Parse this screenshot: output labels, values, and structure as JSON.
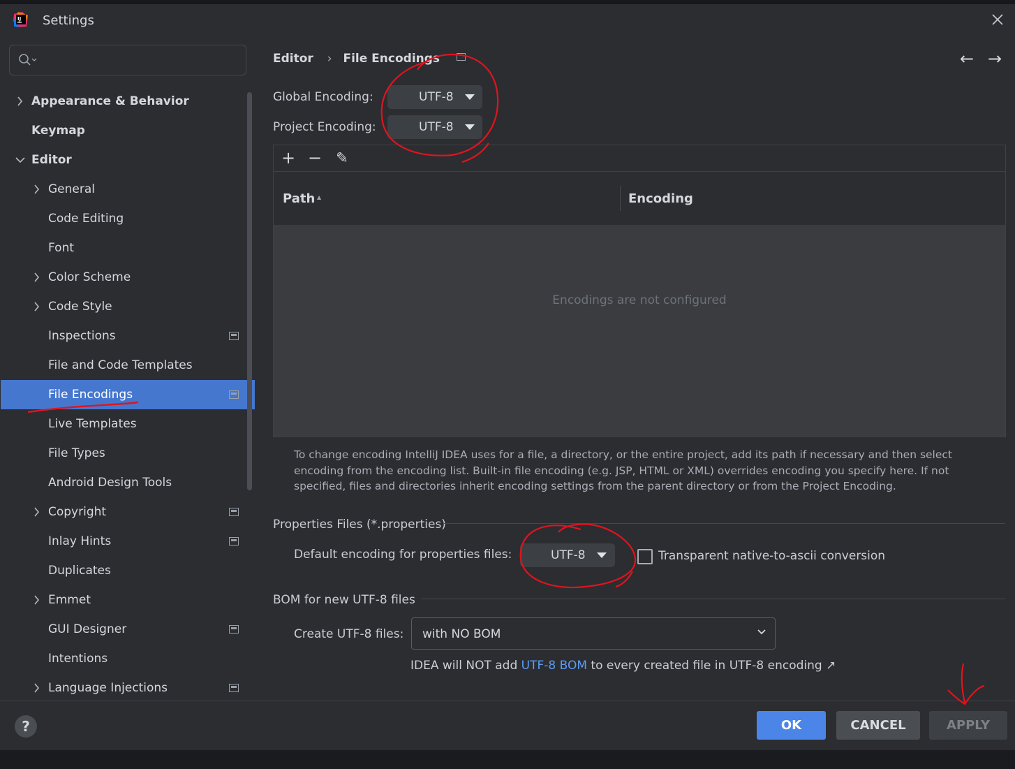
{
  "window": {
    "title": "Settings"
  },
  "search": {
    "placeholder": ""
  },
  "sidebar": {
    "items": [
      {
        "label": "Appearance & Behavior"
      },
      {
        "label": "Keymap"
      },
      {
        "label": "Editor"
      },
      {
        "label": "General"
      },
      {
        "label": "Code Editing"
      },
      {
        "label": "Font"
      },
      {
        "label": "Color Scheme"
      },
      {
        "label": "Code Style"
      },
      {
        "label": "Inspections"
      },
      {
        "label": "File and Code Templates"
      },
      {
        "label": "File Encodings"
      },
      {
        "label": "Live Templates"
      },
      {
        "label": "File Types"
      },
      {
        "label": "Android Design Tools"
      },
      {
        "label": "Copyright"
      },
      {
        "label": "Inlay Hints"
      },
      {
        "label": "Duplicates"
      },
      {
        "label": "Emmet"
      },
      {
        "label": "GUI Designer"
      },
      {
        "label": "Intentions"
      },
      {
        "label": "Language Injections"
      }
    ],
    "selected": "File Encodings"
  },
  "breadcrumb": {
    "parent": "Editor",
    "current": "File Encodings",
    "separator": "›"
  },
  "nav": {
    "back": "←",
    "forward": "→"
  },
  "encoding": {
    "global_label": "Global Encoding:",
    "global_value": "UTF-8",
    "project_label": "Project Encoding:",
    "project_value": "UTF-8"
  },
  "table": {
    "toolbar": {
      "add": "+",
      "remove": "−",
      "edit": "✎"
    },
    "columns": [
      "Path",
      "Encoding"
    ],
    "sort_indicator": "▲",
    "empty_text": "Encodings are not configured"
  },
  "help_text": "To change encoding IntelliJ IDEA uses for a file, a directory, or the entire project, add its path if necessary and then select encoding from the encoding list. Built-in file encoding (e.g. JSP, HTML or XML) overrides encoding you specify here. If not specified, files and directories inherit encoding settings from the parent directory or from the Project Encoding.",
  "properties": {
    "section_title": "Properties Files (*.properties)",
    "default_label": "Default encoding for properties files:",
    "default_value": "UTF-8",
    "checkbox_label": "Transparent native-to-ascii conversion",
    "checkbox_checked": false
  },
  "bom": {
    "section_title": "BOM for new UTF-8 files",
    "create_label": "Create UTF-8 files:",
    "create_value": "with NO BOM",
    "note_prefix": "IDEA will NOT add ",
    "note_link": "UTF-8 BOM",
    "note_suffix": " to every created file in UTF-8 encoding ↗"
  },
  "footer": {
    "help": "?",
    "ok": "OK",
    "cancel": "CANCEL",
    "apply": "APPLY"
  },
  "colors": {
    "background": "#2b2d31",
    "selection": "#4577cf",
    "ok_button": "#4b85e8",
    "link": "#5c9cf2",
    "annotation": "#e0141e"
  }
}
